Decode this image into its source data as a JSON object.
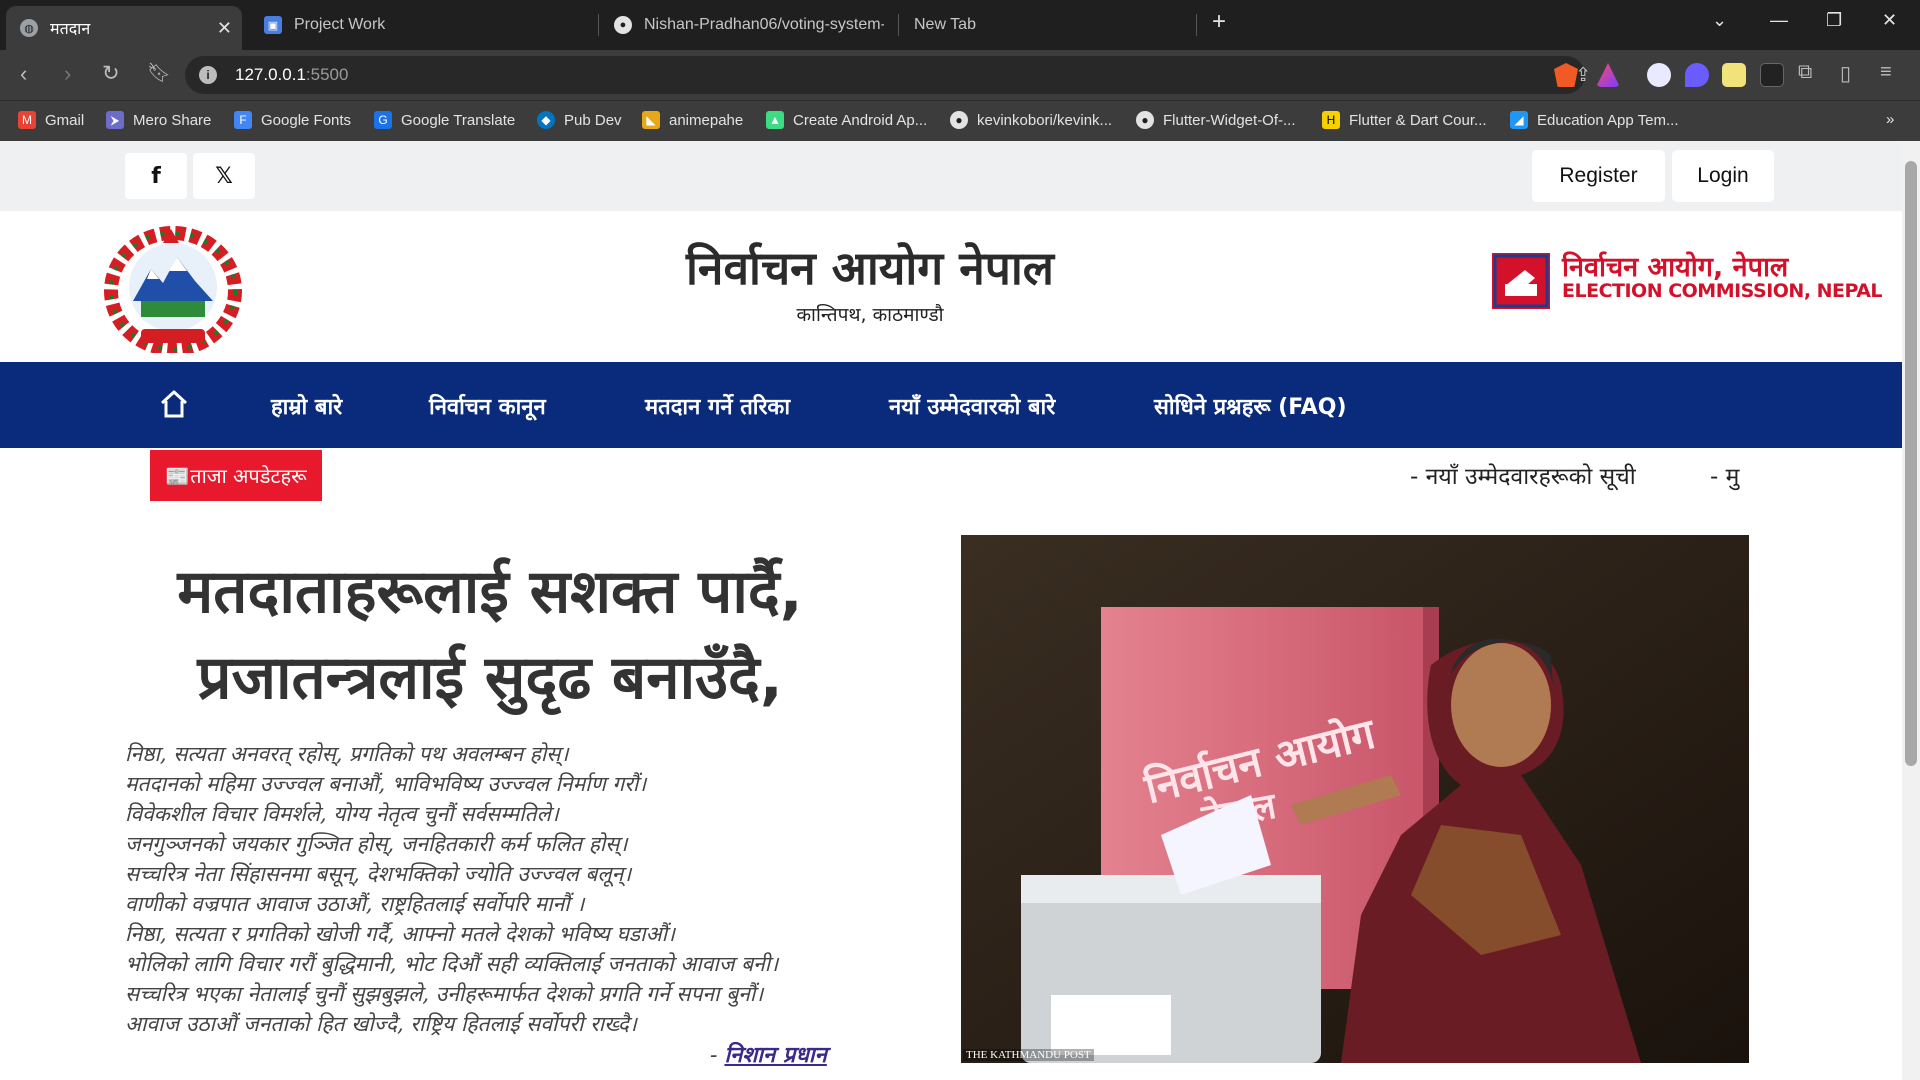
{
  "browser": {
    "tabs": [
      {
        "title": "मतदान",
        "active": true
      },
      {
        "title": "Project Work"
      },
      {
        "title": "Nishan-Pradhan06/voting-system-ht"
      },
      {
        "title": "New Tab"
      }
    ],
    "url_host": "127.0.0.1",
    "url_port": ":5500",
    "bookmarks": [
      "Gmail",
      "Mero Share",
      "Google Fonts",
      "Google Translate",
      "Pub Dev",
      "animepahe",
      "Create Android Ap...",
      "kevinkobori/kevink...",
      "Flutter-Widget-Of-...",
      "Flutter & Dart Cour...",
      "Education App Tem..."
    ],
    "bookmarks_overflow": "»"
  },
  "topbar": {
    "social": [
      {
        "icon": "facebook-icon",
        "glyph": "f"
      },
      {
        "icon": "x-twitter-icon",
        "glyph": "𝕏"
      }
    ],
    "register": "Register",
    "login": "Login"
  },
  "header": {
    "title": "निर्वाचन आयोग नेपाल",
    "subtitle": "कान्तिपथ, काठमाण्डौ",
    "ec_logo_np": "निर्वाचन आयोग, नेपाल",
    "ec_logo_en": "ELECTION COMMISSION, NEPAL"
  },
  "nav": {
    "home_icon": "home-icon",
    "items": [
      "हाम्रो बारे",
      "निर्वाचन कानून",
      "मतदान गर्ने तरिका",
      "नयाँ उम्मेदवारको बारे",
      "सोधिने प्रश्नहरू (FAQ)"
    ]
  },
  "updates": {
    "badge": "📰ताजा अपडेटहरू",
    "ticker": [
      "- नयाँ उम्मेदवारहरूको सूची",
      "- मु"
    ]
  },
  "hero": {
    "title_line1": "मतदाताहरूलाई सशक्त पार्दै,",
    "title_line2": "प्रजातन्त्रलाई सुदृढ बनाउँदै,",
    "poem": [
      "निष्ठा, सत्यता अनवरत् रहोस्, प्रगतिको पथ अवलम्बन होस्।",
      "मतदानको महिमा उज्ज्वल बनाऔं, भाविभविष्य उज्ज्वल निर्माण गरौं।",
      "विवेकशील विचार विमर्शले, योग्य नेतृत्व चुनौं सर्वसम्मतिले।",
      "जनगुञ्जनको जयकार गुञ्जित होस्, जनहितकारी कर्म फलित होस्।",
      "सच्चरित्र नेता सिंहासनमा बसून्, देशभक्तिको ज्योति उज्ज्वल बलून्।",
      "वाणीको वज्रपात आवाज उठाऔं, राष्ट्रहितलाई सर्वोपरि मानौं ।",
      "निष्ठा, सत्यता र प्रगतिको खोजी गर्दै, आफ्नो मतले देशको भविष्य घडाऔं।",
      "भोलिको लागि विचार गरौं बुद्धिमानी, भोट दिऔं सही व्यक्तिलाई जनताको आवाज बनी।",
      "सच्चरित्र भएका नेतालाई चुनौं सुझबुझले, उनीहरूमार्फत देशको प्रगति गर्ने सपना बुनौं।",
      "आवाज उठाऔं जनताको हित खोज्दै, राष्ट्रिय हितलाई सर्वोपरी राख्दै।"
    ],
    "author_prefix": "- ",
    "author": "निशान प्रधान",
    "photo_credit": "THE KATHMANDU POST",
    "photo_box_text_1": "निर्वाचन आयोग",
    "photo_box_text_2": "नेपाल"
  },
  "colors": {
    "nav_bg": "#0a2a7c",
    "accent_red": "#e8192c",
    "brand_red": "#d3112b"
  }
}
